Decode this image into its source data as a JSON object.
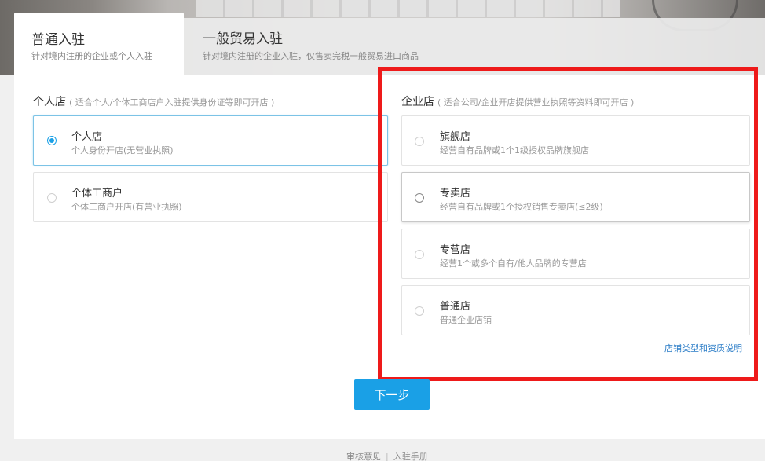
{
  "tabs": [
    {
      "title": "普通入驻",
      "desc": "针对境内注册的企业或个人入驻"
    },
    {
      "title": "一般贸易入驻",
      "desc": "针对境内注册的企业入驻，仅售卖完税一般贸易进口商品"
    }
  ],
  "personal": {
    "title": "个人店",
    "hint": "( 适合个人/个体工商店户入驻提供身份证等即可开店 )",
    "options": [
      {
        "title": "个人店",
        "desc": "个人身份开店(无营业执照)",
        "selected": true
      },
      {
        "title": "个体工商户",
        "desc": "个体工商户开店(有营业执照)",
        "selected": false
      }
    ]
  },
  "enterprise": {
    "title": "企业店",
    "hint": "( 适合公司/企业开店提供营业执照等资料即可开店 )",
    "options": [
      {
        "title": "旗舰店",
        "desc": "经营自有品牌或1个1级授权品牌旗舰店"
      },
      {
        "title": "专卖店",
        "desc": "经营自有品牌或1个授权销售专卖店(≤2级)"
      },
      {
        "title": "专营店",
        "desc": "经营1个或多个自有/他人品牌的专营店"
      },
      {
        "title": "普通店",
        "desc": "普通企业店铺"
      }
    ],
    "link": "店铺类型和资质说明"
  },
  "next_button": "下一步",
  "footer": {
    "feedback": "审核意见",
    "separator": "|",
    "manual": "入驻手册"
  },
  "colors": {
    "accent": "#1aa0e6",
    "highlight": "#ee1a1a",
    "link": "#2a7cc7"
  }
}
